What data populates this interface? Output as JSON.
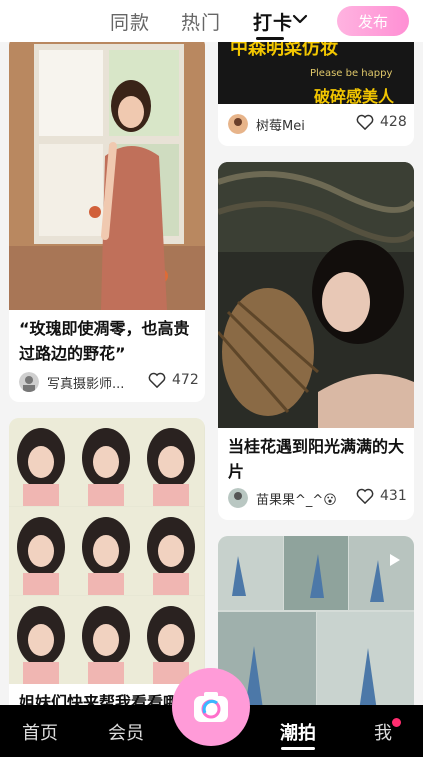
{
  "topbar": {
    "tabs": [
      "同款",
      "热门",
      "打卡"
    ],
    "publish_label": "发布"
  },
  "cards": [
    {
      "title": "“玫瑰即使凋零，也高贵过路边的野花”",
      "author": "写真摄影师...",
      "likes": "472"
    },
    {
      "title": "姐妹们快来帮我看看哪",
      "author": "",
      "likes": ""
    },
    {
      "banner_text_top": "中森明菜仿妆",
      "banner_text_mid": "Please be happy",
      "banner_text_bottom": "破碎感美人",
      "author": "树莓Mei",
      "likes": "428"
    },
    {
      "title": "当桂花遇到阳光满满的大片",
      "author": "苗果果^_^😮",
      "likes": "431"
    }
  ],
  "bottomnav": {
    "items": [
      "首页",
      "会员",
      "潮拍",
      "我"
    ]
  },
  "colors": {
    "accent_pink": "#ff8fd4",
    "notification_dot": "#ff2d6f"
  }
}
